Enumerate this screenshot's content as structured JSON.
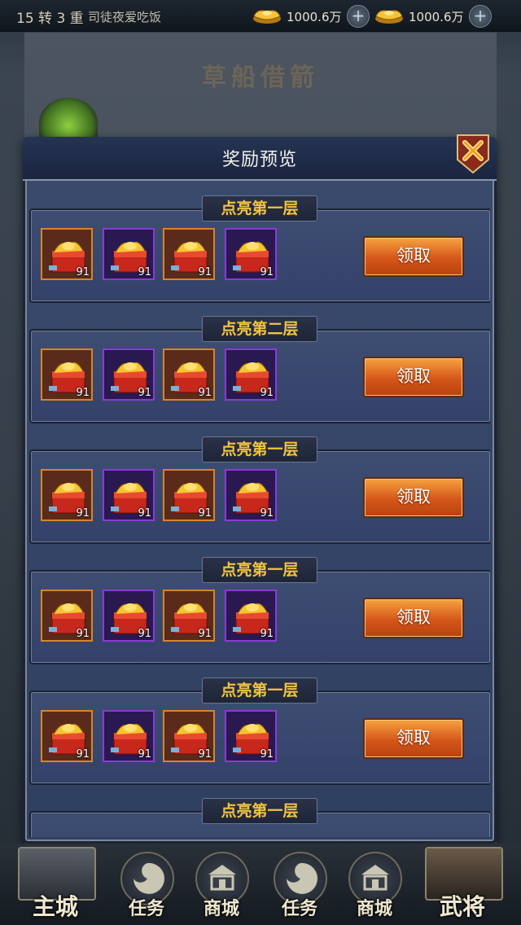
{
  "topbar": {
    "rank": "15 转 3 重",
    "player_name": "司徒夜爱吃饭",
    "currency1": "1000.6万",
    "currency2": "1000.6万"
  },
  "page_title": "草船借箭",
  "modal": {
    "title": "奖励预览",
    "rows": [
      {
        "label": "点亮第一层",
        "claim": "领取",
        "items": [
          {
            "count": "91"
          },
          {
            "count": "91"
          },
          {
            "count": "91"
          },
          {
            "count": "91"
          }
        ]
      },
      {
        "label": "点亮第二层",
        "claim": "领取",
        "items": [
          {
            "count": "91"
          },
          {
            "count": "91"
          },
          {
            "count": "91"
          },
          {
            "count": "91"
          }
        ]
      },
      {
        "label": "点亮第一层",
        "claim": "领取",
        "items": [
          {
            "count": "91"
          },
          {
            "count": "91"
          },
          {
            "count": "91"
          },
          {
            "count": "91"
          }
        ]
      },
      {
        "label": "点亮第一层",
        "claim": "领取",
        "items": [
          {
            "count": "91"
          },
          {
            "count": "91"
          },
          {
            "count": "91"
          },
          {
            "count": "91"
          }
        ]
      },
      {
        "label": "点亮第一层",
        "claim": "领取",
        "items": [
          {
            "count": "91"
          },
          {
            "count": "91"
          },
          {
            "count": "91"
          },
          {
            "count": "91"
          }
        ]
      },
      {
        "label": "点亮第一层"
      }
    ]
  },
  "nav": {
    "home": "主城",
    "task1": "任务",
    "shop1": "商城",
    "task2": "任务",
    "shop2": "商城",
    "generals": "武将"
  },
  "colors": {
    "accent_gold": "#f2c340",
    "claim_orange": "#e06a20",
    "rarity_orange": "#d7852a",
    "rarity_purple": "#8a3ad8"
  },
  "icons": [
    "gold-ingot-icon",
    "plus-icon",
    "close-icon",
    "gift-box-icon",
    "swirl-icon",
    "shop-icon"
  ]
}
